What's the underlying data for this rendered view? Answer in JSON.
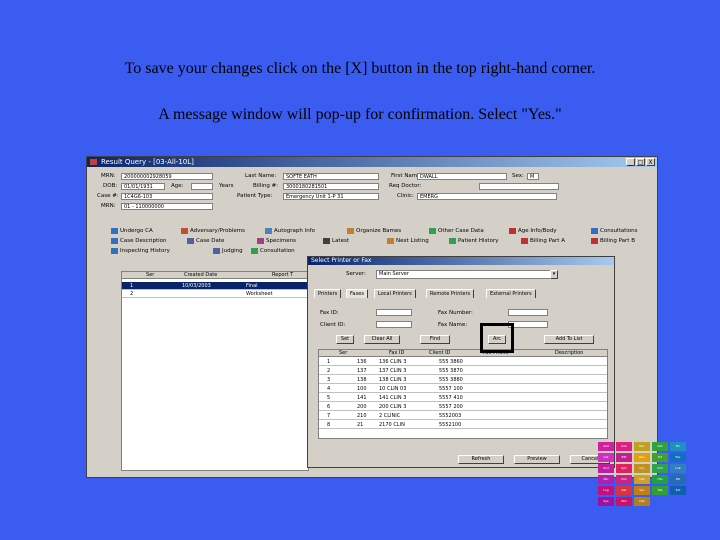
{
  "caption": {
    "line1": "To save your changes click on the [X] button in the top right-hand corner.",
    "line2": "A message window will pop-up for confirmation. Select \"Yes.\""
  },
  "window": {
    "title": "Result Query - [03-All-10L]",
    "controls": [
      "_",
      "□",
      "X"
    ],
    "fields": [
      {
        "label": "MRN:",
        "value": "200000002928059"
      },
      {
        "label": "Last Name:",
        "value": "SOFTE EATH"
      },
      {
        "label": "First Name:",
        "value": "DWALL"
      },
      {
        "label": "Sex:",
        "value": "M"
      },
      {
        "label": "DOB:",
        "value": "01/01/1931"
      },
      {
        "label": "Age:",
        "value": "1"
      },
      {
        "label": "Years",
        "value": ""
      },
      {
        "label": "Billing #:",
        "value": "3000180281501"
      },
      {
        "label": "Req Doctor:",
        "value": ""
      },
      {
        "label": "Case #:",
        "value": "1C4G6-103"
      },
      {
        "label": "Patient Type:",
        "value": "Emergency Unit 1-P 31"
      },
      {
        "label": "Clinic:",
        "value": "EMERG"
      },
      {
        "label": "MRN:",
        "value": "01 - 110000000"
      }
    ],
    "toolbar_row1": [
      "Undergo CA",
      "Adversary/Problems",
      "Autograph Info",
      "Organize Bames",
      "Other Case Data",
      "Age Info/Body",
      "Consultations"
    ],
    "toolbar_row2": [
      "Case Description",
      "Case Date",
      "Specimens",
      "Latest",
      "Next Listing",
      "Patient History",
      "Billing Part A",
      "Billing Part B"
    ],
    "toolbar_row3": [
      "Inspecting History",
      "Judging",
      "Consultation"
    ],
    "list_headers": [
      "Ser",
      "Created Date",
      "Report T"
    ],
    "list_rows": [
      {
        "num": "1",
        "date": "10/03/2003",
        "type": "Final"
      },
      {
        "num": "2",
        "date": "",
        "type": "Worksheet"
      }
    ]
  },
  "dialog": {
    "title": "Select Printer or Fax",
    "server_label": "Server:",
    "server_value": "Main Server",
    "tabs": [
      "Printers",
      "Faxes",
      "Local Printers",
      "Remote Printers",
      "External Printers"
    ],
    "fax_id_label": "Fax ID:",
    "client_id_label": "Client ID:",
    "fax_number_label": "Fax Number:",
    "fax_name_label": "Fax Name:",
    "buttons": [
      "Set",
      "Clear All",
      "Find",
      "Arc",
      "Add To List"
    ],
    "table_headers": [
      "Ser",
      "Fax ID",
      "Client ID",
      "Fax Phone",
      "Description"
    ],
    "table_rows": [
      {
        "n": "1",
        "id": "136",
        "client": "136 CLIN 3",
        "phone": "555 3860"
      },
      {
        "n": "2",
        "id": "137",
        "client": "137 CLIN 3",
        "phone": "555 3870"
      },
      {
        "n": "3",
        "id": "138",
        "client": "138 CLIN 3",
        "phone": "555 3880"
      },
      {
        "n": "4",
        "id": "100",
        "client": "10 CLIN 03",
        "phone": "5557 100"
      },
      {
        "n": "5",
        "id": "141",
        "client": "141 CLIN 3",
        "phone": "5557 410"
      },
      {
        "n": "6",
        "id": "200",
        "client": "200 CLIN 3",
        "phone": "5557 200"
      },
      {
        "n": "7",
        "id": "210",
        "client": "2 CLINIC",
        "phone": "5552003"
      },
      {
        "n": "8",
        "id": "21",
        "client": "2170 CLIN",
        "phone": "5552100"
      }
    ],
    "footer_buttons": [
      "Refresh",
      "Preview",
      "Cancel"
    ]
  },
  "colors": {
    "background": "#3b5cf0",
    "title_bar": "#0a246a",
    "highlight_box": "#000000"
  },
  "decoration": {
    "cells": [
      "Add",
      "Sub",
      "Rec",
      "Del",
      "Fin",
      "Cal",
      "Edt",
      "Nav",
      "Prt",
      "Fax",
      "Snd",
      "Rpt",
      "Qry",
      "Ord",
      "Lab",
      "Mic",
      "Chk",
      "Opt",
      "Hlp",
      "Dtl",
      "Log",
      "Set",
      "Sec",
      "Tab",
      "Ext",
      "Sys",
      "Win",
      "Dsk"
    ]
  }
}
